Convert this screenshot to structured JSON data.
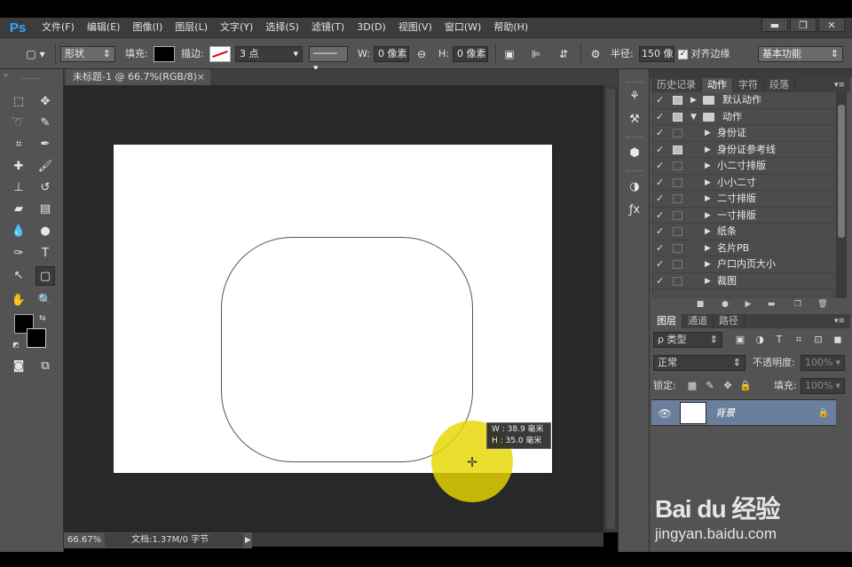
{
  "app": {
    "logo": "Ps"
  },
  "menu": [
    "文件(F)",
    "编辑(E)",
    "图像(I)",
    "图层(L)",
    "文字(Y)",
    "选择(S)",
    "滤镜(T)",
    "3D(D)",
    "视图(V)",
    "窗口(W)",
    "帮助(H)"
  ],
  "window_controls": {
    "minimize": "▬",
    "restore": "❐",
    "close": "✕"
  },
  "options": {
    "mode": "形状",
    "fill_label": "填充:",
    "stroke_label": "描边:",
    "stroke_width": "3 点",
    "w_label": "W:",
    "w_value": "0 像素",
    "h_label": "H:",
    "h_value": "0 像素",
    "radius_label": "半径:",
    "radius_value": "150 像",
    "align_edges_label": "对齐边缘",
    "workspace": "基本功能"
  },
  "document": {
    "tab_title": "未标题-1 @ 66.7%(RGB/8)",
    "zoom": "66.67%",
    "doc_info": "文档:1.37M/0 字节",
    "tooltip_w": "W :   38.9 毫米",
    "tooltip_h": "H :   35.0 毫米"
  },
  "history_panel": {
    "tabs": [
      "历史记录",
      "动作",
      "字符",
      "段落"
    ],
    "active_tab": "动作",
    "actions": [
      {
        "label": "默认动作",
        "kind": "set",
        "expanded": false,
        "dialog": true
      },
      {
        "label": "动作",
        "kind": "set",
        "expanded": true,
        "dialog": true
      },
      {
        "label": "身份证",
        "kind": "action",
        "dialog": false
      },
      {
        "label": "身份证参考线",
        "kind": "action",
        "dialog": true
      },
      {
        "label": "小二寸排版",
        "kind": "action",
        "dialog": false
      },
      {
        "label": "小小二寸",
        "kind": "action",
        "dialog": false
      },
      {
        "label": "二寸排版",
        "kind": "action",
        "dialog": false
      },
      {
        "label": "一寸排版",
        "kind": "action",
        "dialog": false
      },
      {
        "label": "纸条",
        "kind": "action",
        "dialog": false
      },
      {
        "label": "名片PB",
        "kind": "action",
        "dialog": false
      },
      {
        "label": "户口内页大小",
        "kind": "action",
        "dialog": false
      },
      {
        "label": "裁图",
        "kind": "action",
        "dialog": false
      }
    ]
  },
  "layers_panel": {
    "tabs": [
      "图层",
      "通道",
      "路径"
    ],
    "filter_kind": "ρ 类型",
    "blend_mode": "正常",
    "opacity_label": "不透明度:",
    "opacity_value": "100%",
    "lock_label": "锁定:",
    "fill_label": "填充:",
    "fill_value": "100%",
    "layers": [
      {
        "name": "背景",
        "locked": true
      }
    ]
  },
  "watermark": {
    "logo": "Bai du 经验",
    "url": "jingyan.baidu.com"
  },
  "colors": {
    "accent": "#31a8ff",
    "selected_layer": "#6b7f9c",
    "cursor_halo": "#e8d700"
  }
}
